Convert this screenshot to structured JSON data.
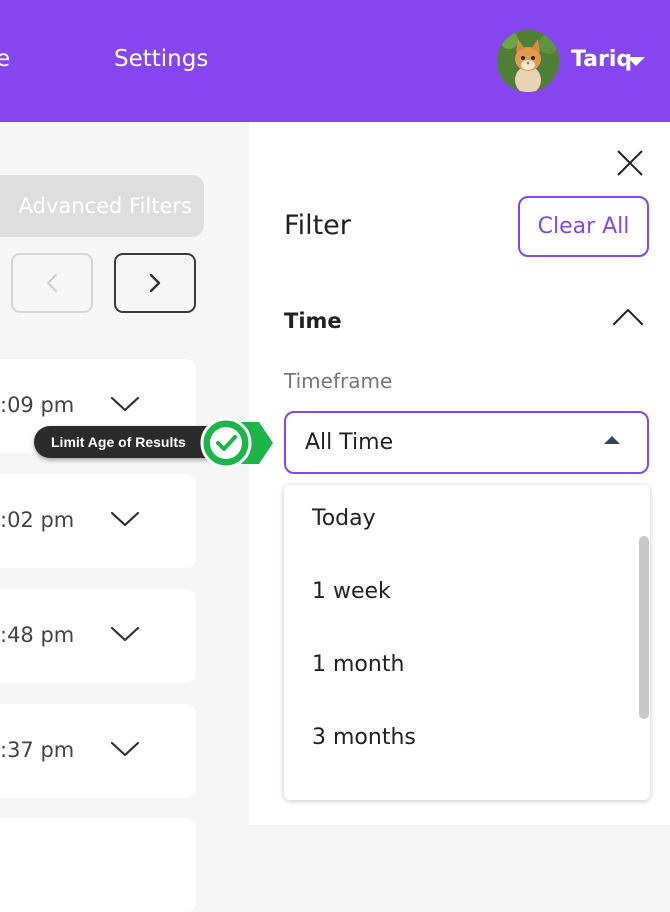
{
  "header": {
    "nav_partial": "e",
    "nav_settings": "Settings",
    "user_name": "Tariq"
  },
  "list": {
    "advanced_filters_label": "Advanced Filters",
    "cards": [
      {
        "time": ":09 pm"
      },
      {
        "time": ":02 pm"
      },
      {
        "time": ":48 pm"
      },
      {
        "time": ":37 pm"
      }
    ]
  },
  "tooltip": {
    "label": "Limit Age of Results"
  },
  "filter_panel": {
    "title": "Filter",
    "clear_all_label": "Clear All",
    "section_title": "Time",
    "field_label": "Timeframe",
    "selected_value": "All Time",
    "options": [
      "Today",
      "1 week",
      "1 month",
      "3 months"
    ]
  },
  "colors": {
    "brand": "#8546ef",
    "tooltip_bg": "#2b2b2b",
    "check_green": "#1db44a"
  }
}
